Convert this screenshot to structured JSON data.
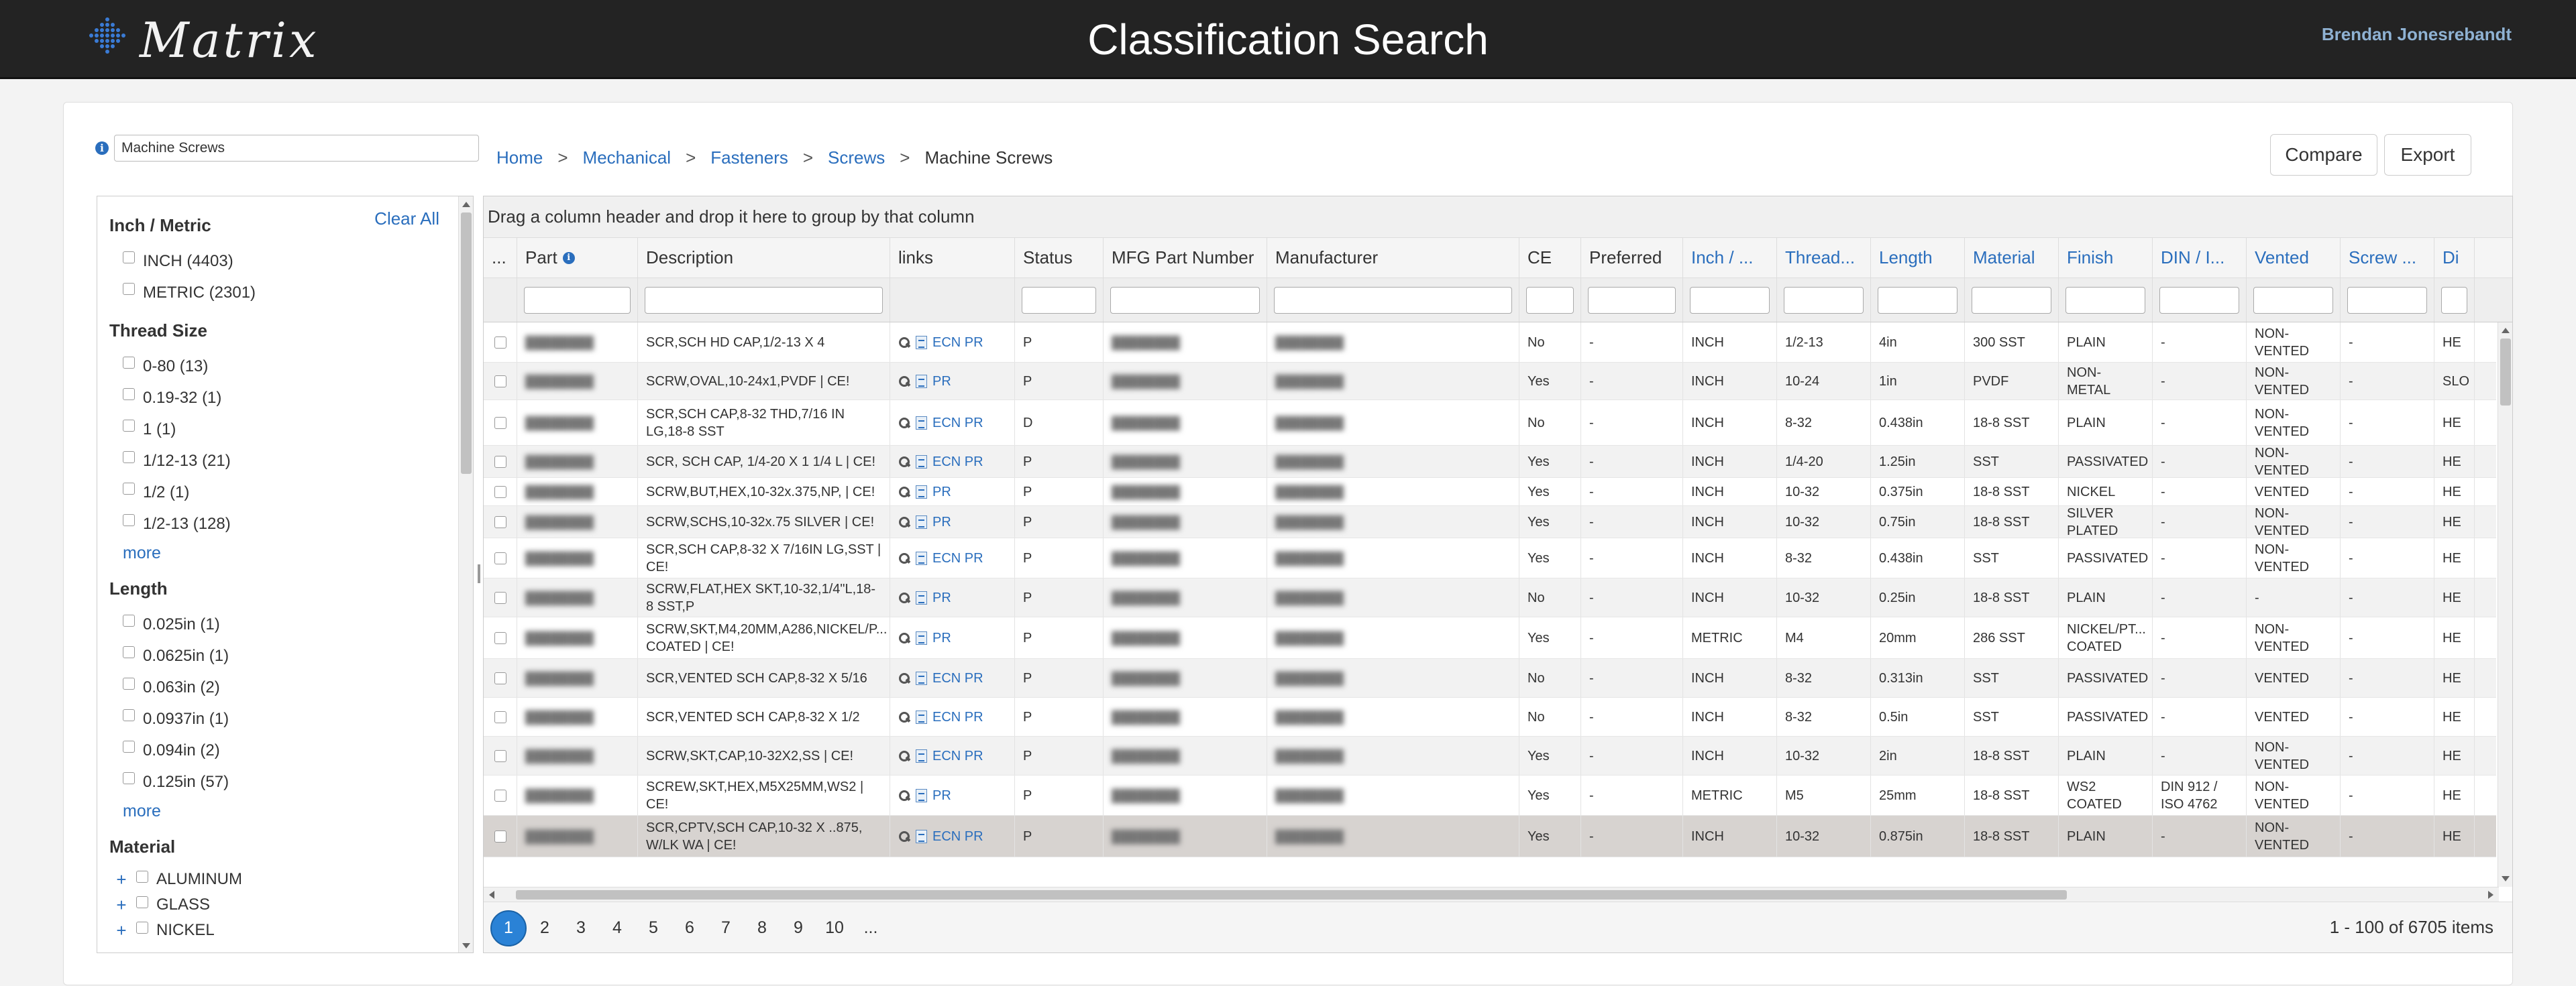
{
  "app": {
    "logo_text": "Matrix",
    "title": "Classification Search",
    "user": "Brendan Jonesrebandt"
  },
  "search": {
    "value": "Machine Screws"
  },
  "breadcrumb": [
    "Home",
    "Mechanical",
    "Fasteners",
    "Screws",
    "Machine Screws"
  ],
  "actions": {
    "compare": "Compare",
    "export": "Export"
  },
  "sidebar": {
    "clear_all": "Clear All",
    "facets": [
      {
        "title": "Inch / Metric",
        "items": [
          "INCH  (4403)",
          "METRIC  (2301)"
        ],
        "more": ""
      },
      {
        "title": "Thread Size",
        "items": [
          "0-80  (13)",
          "0.19-32  (1)",
          "1  (1)",
          "1/12-13  (21)",
          "1/2  (1)",
          "1/2-13  (128)"
        ],
        "more": "more"
      },
      {
        "title": "Length",
        "items": [
          "0.025in  (1)",
          "0.0625in  (1)",
          "0.063in  (2)",
          "0.0937in  (1)",
          "0.094in  (2)",
          "0.125in  (57)"
        ],
        "more": "more"
      }
    ],
    "material": {
      "title": "Material",
      "items": [
        "ALUMINUM",
        "GLASS",
        "NICKEL"
      ]
    }
  },
  "grid": {
    "group_hint": "Drag a column header and drop it here to group by that column",
    "columns": [
      "...",
      "Part",
      "Description",
      "links",
      "Status",
      "MFG Part Number",
      "Manufacturer",
      "CE",
      "Preferred",
      "Inch / ...",
      "Thread...",
      "Length",
      "Material",
      "Finish",
      "DIN / I...",
      "Vented",
      "Screw ...",
      "Di"
    ],
    "rows": [
      {
        "part": "",
        "desc": "SCR,SCH HD CAP,1/2-13 X 4",
        "links": "ECN PR",
        "status": "P",
        "mfg": "",
        "mfr": "",
        "ce": "No",
        "pref": "-",
        "inch": "INCH",
        "thread": "1/2-13",
        "length": "4in",
        "material": "300 SST",
        "finish": "PLAIN",
        "din": "-",
        "vented": "NON-VENTED",
        "screw": "-",
        "di": "HE"
      },
      {
        "part": "",
        "desc": "SCRW,OVAL,10-24x1,PVDF | CE!",
        "links": "PR",
        "status": "P",
        "mfg": "",
        "mfr": "",
        "ce": "Yes",
        "pref": "-",
        "inch": "INCH",
        "thread": "10-24",
        "length": "1in",
        "material": "PVDF",
        "finish": "NON-METAL",
        "din": "-",
        "vented": "NON-VENTED",
        "screw": "-",
        "di": "SLO"
      },
      {
        "part": "",
        "desc": "SCR,SCH CAP,8-32 THD,7/16 IN LG,18-8 SST",
        "links": "ECN PR",
        "status": "D",
        "mfg": "",
        "mfr": "",
        "ce": "No",
        "pref": "-",
        "inch": "INCH",
        "thread": "8-32",
        "length": "0.438in",
        "material": "18-8 SST",
        "finish": "PLAIN",
        "din": "-",
        "vented": "NON-VENTED",
        "screw": "-",
        "di": "HE"
      },
      {
        "part": "",
        "desc": "SCR, SCH CAP, 1/4-20 X 1 1/4 L | CE!",
        "links": "ECN PR",
        "status": "P",
        "mfg": "",
        "mfr": "",
        "ce": "Yes",
        "pref": "-",
        "inch": "INCH",
        "thread": "1/4-20",
        "length": "1.25in",
        "material": "SST",
        "finish": "PASSIVATED",
        "din": "-",
        "vented": "NON-VENTED",
        "screw": "-",
        "di": "HE"
      },
      {
        "part": "",
        "desc": "SCRW,BUT,HEX,10-32x.375,NP, | CE!",
        "links": "PR",
        "status": "P",
        "mfg": "",
        "mfr": "",
        "ce": "Yes",
        "pref": "-",
        "inch": "INCH",
        "thread": "10-32",
        "length": "0.375in",
        "material": "18-8 SST",
        "finish": "NICKEL",
        "din": "-",
        "vented": "VENTED",
        "screw": "-",
        "di": "HE"
      },
      {
        "part": "",
        "desc": "SCRW,SCHS,10-32x.75 SILVER | CE!",
        "links": "PR",
        "status": "P",
        "mfg": "",
        "mfr": "",
        "ce": "Yes",
        "pref": "-",
        "inch": "INCH",
        "thread": "10-32",
        "length": "0.75in",
        "material": "18-8 SST",
        "finish": "SILVER PLATED",
        "din": "-",
        "vented": "NON-VENTED",
        "screw": "-",
        "di": "HE"
      },
      {
        "part": "",
        "desc": "SCR,SCH CAP,8-32 X 7/16IN LG,SST | CE!",
        "links": "ECN PR",
        "status": "P",
        "mfg": "",
        "mfr": "",
        "ce": "Yes",
        "pref": "-",
        "inch": "INCH",
        "thread": "8-32",
        "length": "0.438in",
        "material": "SST",
        "finish": "PASSIVATED",
        "din": "-",
        "vented": "NON-VENTED",
        "screw": "-",
        "di": "HE"
      },
      {
        "part": "",
        "desc": "SCRW,FLAT,HEX SKT,10-32,1/4\"L,18-8 SST,P",
        "links": "PR",
        "status": "P",
        "mfg": "",
        "mfr": "",
        "ce": "No",
        "pref": "-",
        "inch": "INCH",
        "thread": "10-32",
        "length": "0.25in",
        "material": "18-8 SST",
        "finish": "PLAIN",
        "din": "-",
        "vented": "-",
        "screw": "-",
        "di": "HE"
      },
      {
        "part": "",
        "desc": "SCRW,SKT,M4,20MM,A286,NICKEL/P... COATED | CE!",
        "links": "PR",
        "status": "P",
        "mfg": "",
        "mfr": "",
        "ce": "Yes",
        "pref": "-",
        "inch": "METRIC",
        "thread": "M4",
        "length": "20mm",
        "material": "286 SST",
        "finish": "NICKEL/PT... COATED",
        "din": "-",
        "vented": "NON-VENTED",
        "screw": "-",
        "di": "HE"
      },
      {
        "part": "",
        "desc": "SCR,VENTED SCH CAP,8-32 X 5/16",
        "links": "ECN PR",
        "status": "P",
        "mfg": "",
        "mfr": "",
        "ce": "No",
        "pref": "-",
        "inch": "INCH",
        "thread": "8-32",
        "length": "0.313in",
        "material": "SST",
        "finish": "PASSIVATED",
        "din": "-",
        "vented": "VENTED",
        "screw": "-",
        "di": "HE"
      },
      {
        "part": "",
        "desc": "SCR,VENTED SCH CAP,8-32 X 1/2",
        "links": "ECN PR",
        "status": "P",
        "mfg": "",
        "mfr": "",
        "ce": "No",
        "pref": "-",
        "inch": "INCH",
        "thread": "8-32",
        "length": "0.5in",
        "material": "SST",
        "finish": "PASSIVATED",
        "din": "-",
        "vented": "VENTED",
        "screw": "-",
        "di": "HE"
      },
      {
        "part": "",
        "desc": "SCRW,SKT,CAP,10-32X2,SS | CE!",
        "links": "ECN PR",
        "status": "P",
        "mfg": "",
        "mfr": "",
        "ce": "Yes",
        "pref": "-",
        "inch": "INCH",
        "thread": "10-32",
        "length": "2in",
        "material": "18-8 SST",
        "finish": "PLAIN",
        "din": "-",
        "vented": "NON-VENTED",
        "screw": "-",
        "di": "HE"
      },
      {
        "part": "",
        "desc": "SCREW,SKT,HEX,M5X25MM,WS2 | CE!",
        "links": "PR",
        "status": "P",
        "mfg": "",
        "mfr": "",
        "ce": "Yes",
        "pref": "-",
        "inch": "METRIC",
        "thread": "M5",
        "length": "25mm",
        "material": "18-8 SST",
        "finish": "WS2 COATED",
        "din": "DIN 912 / ISO 4762",
        "vented": "NON-VENTED",
        "screw": "-",
        "di": "HE"
      },
      {
        "part": "",
        "desc": "SCR,CPTV,SCH CAP,10-32 X ..875, W/LK WA | CE!",
        "links": "ECN PR",
        "status": "P",
        "mfg": "",
        "mfr": "",
        "ce": "Yes",
        "pref": "-",
        "inch": "INCH",
        "thread": "10-32",
        "length": "0.875in",
        "material": "18-8 SST",
        "finish": "PLAIN",
        "din": "-",
        "vented": "NON-VENTED",
        "screw": "-",
        "di": "HE"
      }
    ],
    "pages": [
      "1",
      "2",
      "3",
      "4",
      "5",
      "6",
      "7",
      "8",
      "9",
      "10",
      "..."
    ],
    "summary": "1 - 100 of 6705 items"
  },
  "colors": {
    "accent": "#2a6ebd",
    "topbar": "#232323",
    "active_page": "#2a82d6"
  }
}
